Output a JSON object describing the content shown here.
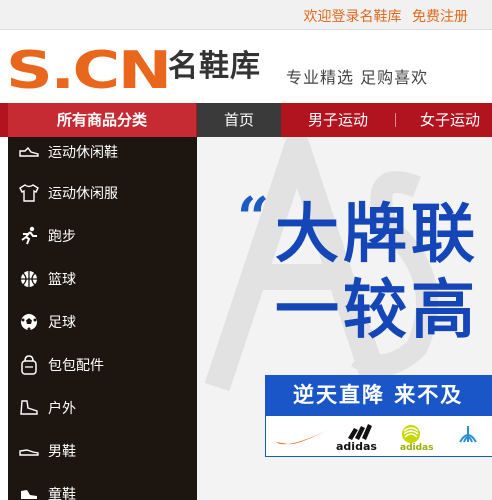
{
  "topbar": {
    "welcome": "欢迎登录名鞋库",
    "register": "免费注册"
  },
  "header": {
    "logo_mark": "S.CN",
    "logo_text": "名鞋库",
    "slogan": "专业精选 足购喜欢"
  },
  "nav": {
    "category_title": "所有商品分类",
    "items": [
      "首页",
      "男子运动",
      "女子运动"
    ]
  },
  "sidebar": {
    "categories": [
      {
        "label": "运动休闲鞋",
        "icon": "sneaker-icon"
      },
      {
        "label": "运动休闲服",
        "icon": "tshirt-icon"
      },
      {
        "label": "跑步",
        "icon": "runner-icon"
      },
      {
        "label": "篮球",
        "icon": "basketball-icon"
      },
      {
        "label": "足球",
        "icon": "soccer-ball-icon"
      },
      {
        "label": "包包配件",
        "icon": "bag-icon"
      },
      {
        "label": "户外",
        "icon": "hiking-boot-icon"
      },
      {
        "label": "男鞋",
        "icon": "mens-shoe-icon"
      },
      {
        "label": "童鞋",
        "icon": "kids-shoe-icon"
      }
    ]
  },
  "banner": {
    "quote_mark": "“",
    "line1": "大牌联",
    "line2": "一较高",
    "strip": "逆天直降  来不及",
    "brands": [
      "adidas",
      "adidas"
    ]
  },
  "colors": {
    "brand_orange": "#e8671d",
    "nav_red": "#b1141f",
    "sidebar_dark": "#1c1510",
    "banner_blue": "#1446b8"
  }
}
